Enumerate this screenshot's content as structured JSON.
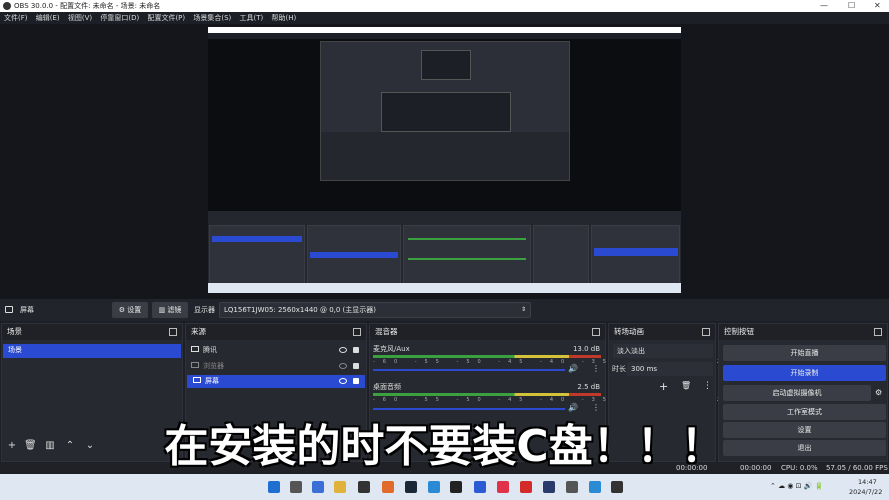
{
  "window": {
    "title": "OBS 30.0.0 - 配置文件: 未命名 - 场景: 未命名"
  },
  "menu": [
    "文件(F)",
    "编辑(E)",
    "视图(V)",
    "停靠窗口(D)",
    "配置文件(P)",
    "场景集合(S)",
    "工具(T)",
    "帮助(H)"
  ],
  "toolbar": {
    "source_name": "屏幕",
    "settings_label": "设置",
    "filters_label": "滤镜",
    "display_label": "显示器",
    "display_value": "LQ156T1JW05: 2560x1440 @ 0,0 (主显示器)"
  },
  "scenes": {
    "title": "场景",
    "items": [
      "场景"
    ]
  },
  "sources": {
    "title": "来源",
    "items": [
      {
        "name": "腾讯"
      },
      {
        "name": "浏览器"
      },
      {
        "name": "屏幕"
      }
    ]
  },
  "mixer": {
    "title": "混音器",
    "tracks": [
      {
        "name": "麦克风/Aux",
        "db": "13.0 dB"
      },
      {
        "name": "桌面音频",
        "db": "2.5 dB"
      }
    ],
    "scale": "-60 -55 -50 -45 -40 -35 -30 -25 -20 -15 -10 -5 0"
  },
  "transitions": {
    "title": "转场动画",
    "type": "淡入淡出",
    "duration_label": "时长",
    "duration_value": "300 ms"
  },
  "controls": {
    "title": "控制按钮",
    "buttons": [
      "开始直播",
      "开始录制",
      "启动虚拟摄像机",
      "工作室模式",
      "设置",
      "退出"
    ]
  },
  "status": {
    "time1": "00:00:00",
    "time2": "00:00:00",
    "cpu": "CPU: 0.0%",
    "fps": "57.05 / 60.00 FPS"
  },
  "taskbar": {
    "time": "14:47",
    "date": "2024/7/22"
  },
  "subtitle": "在安装的时不要装C盘！！！",
  "colors": {
    "accent": "#2a4bd1",
    "panel": "#272930",
    "bg": "#1d1f26"
  }
}
